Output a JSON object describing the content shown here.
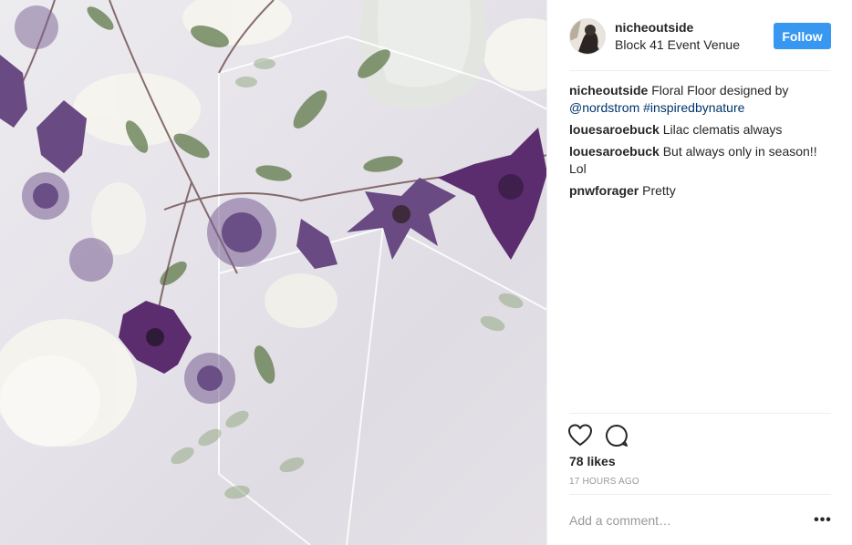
{
  "post": {
    "username": "nicheoutside",
    "location": "Block 41 Event Venue",
    "follow_label": "Follow",
    "caption": {
      "username": "nicheoutside",
      "text_before": "Floral Floor designed by ",
      "mention": "@nordstrom",
      "space": " ",
      "hashtag": "#inspiredbynature"
    },
    "comments": [
      {
        "username": "louesaroebuck",
        "text": "Lilac clematis always"
      },
      {
        "username": "louesaroebuck",
        "text": "But always only in season!! Lol"
      },
      {
        "username": "pnwforager",
        "text": "Pretty"
      }
    ],
    "likes": "78 likes",
    "timestamp": "17 HOURS AGO",
    "comment_placeholder": "Add a comment…",
    "more_label": "•••"
  },
  "icons": {
    "like": "heart-icon",
    "comment": "comment-icon",
    "more": "more-options-icon"
  },
  "colors": {
    "follow_button": "#3897f0",
    "link": "#003569",
    "muted": "#999999",
    "text": "#262626"
  }
}
